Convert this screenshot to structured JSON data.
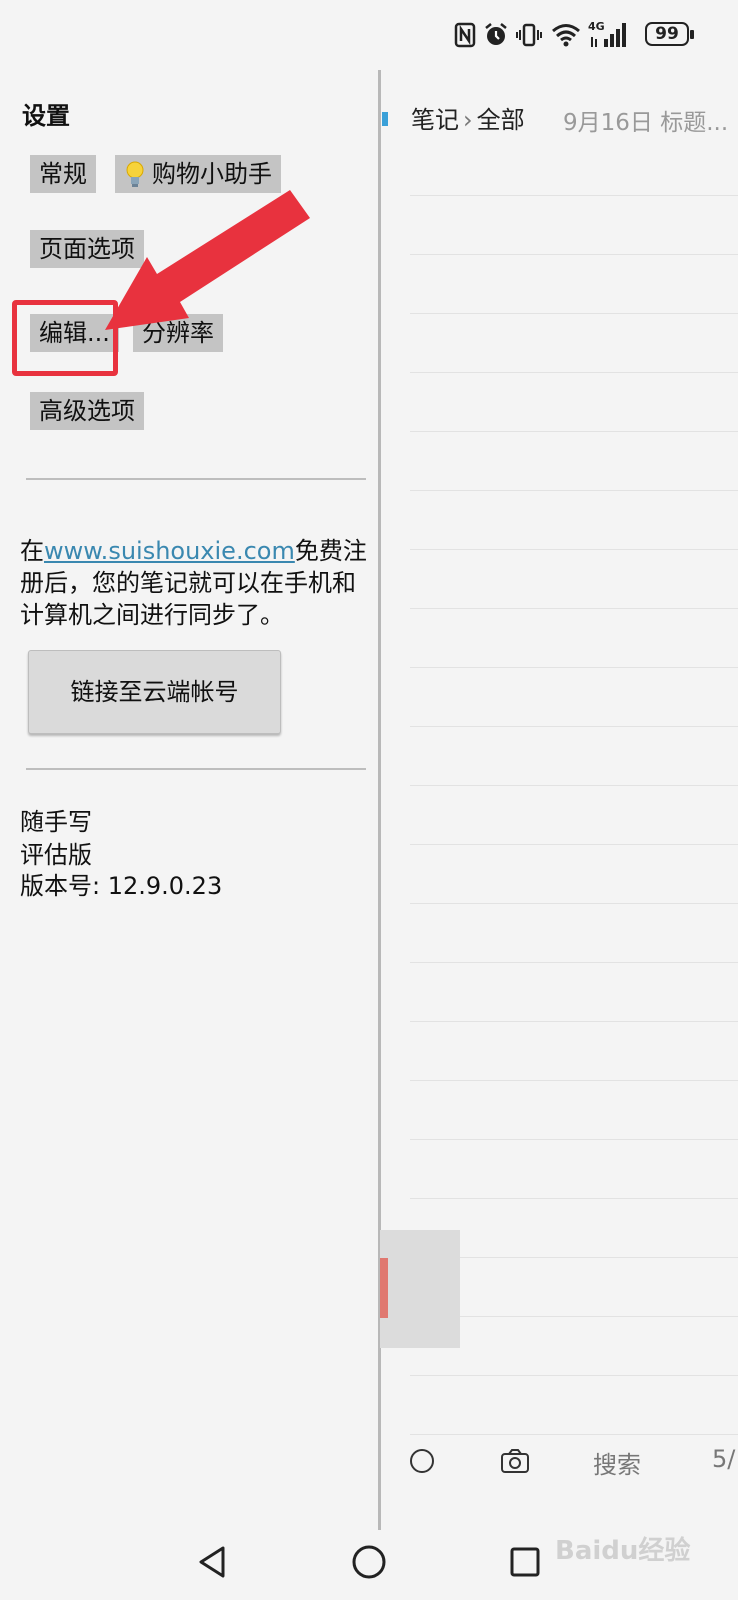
{
  "status_bar": {
    "battery_level": "99",
    "network_label": "4G",
    "icons": [
      "nfc-icon",
      "alarm-icon",
      "vibrate-icon",
      "wifi-icon",
      "signal-icon",
      "battery-icon"
    ]
  },
  "settings": {
    "title": "设置",
    "menu": {
      "general": "常规",
      "shopping_assistant": "购物小助手",
      "page_options": "页面选项",
      "edit": "编辑...",
      "resolution": "分辨率",
      "advanced": "高级选项"
    },
    "sync": {
      "prefix": "在",
      "link": "www.suishouxie.com",
      "suffix": "免费注册后，您的笔记就可以在手机和计算机之间进行同步了。"
    },
    "link_button": "链接至云端帐号",
    "about": {
      "app_name": "随手写",
      "edition": "评估版",
      "version": "版本号: 12.9.0.23"
    }
  },
  "notes": {
    "breadcrumb_root": "笔记",
    "breadcrumb_current": "全部",
    "meta": "9月16日  标题...",
    "toolbar": {
      "search": "搜索",
      "page": "5/"
    }
  },
  "watermark": "Baidu经验",
  "colors": {
    "highlight": "#e8323e",
    "link": "#3a88b0",
    "chip_bg": "#c4c4c4"
  }
}
